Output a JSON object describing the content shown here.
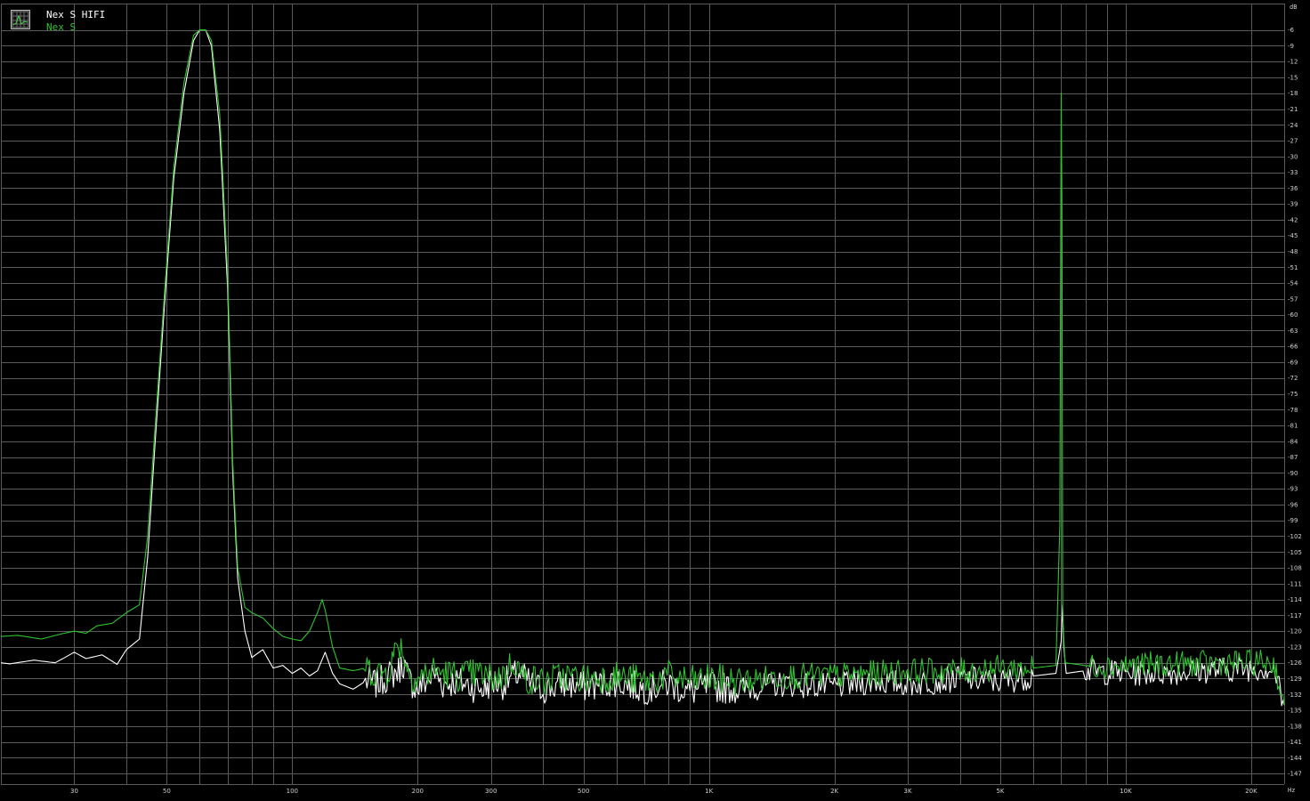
{
  "legend": {
    "series_1": "Nex S HIFI",
    "series_2": "Nex S"
  },
  "colors": {
    "background": "#000000",
    "grid": "#5a5a5a",
    "series_1": "#ffffff",
    "series_2": "#2ec22e",
    "tick_text": "#d0d0d0"
  },
  "icons": {
    "legend": "chart-grid-icon"
  },
  "chart_data": {
    "type": "line",
    "title": "",
    "xlabel": "Hz",
    "ylabel": "dB",
    "xscale": "log",
    "xlim": [
      20,
      24000
    ],
    "ylim": [
      -149,
      -1
    ],
    "grid": true,
    "legend_position": "top-left",
    "x_ticks": [
      {
        "value": 30,
        "label": "30"
      },
      {
        "value": 50,
        "label": "50"
      },
      {
        "value": 100,
        "label": "100"
      },
      {
        "value": 200,
        "label": "200"
      },
      {
        "value": 300,
        "label": "300"
      },
      {
        "value": 500,
        "label": "500"
      },
      {
        "value": 1000,
        "label": "1K"
      },
      {
        "value": 2000,
        "label": "2K"
      },
      {
        "value": 3000,
        "label": "3K"
      },
      {
        "value": 5000,
        "label": "5K"
      },
      {
        "value": 10000,
        "label": "10K"
      },
      {
        "value": 20000,
        "label": "20K"
      }
    ],
    "x_grid_minor": [
      20,
      40,
      60,
      70,
      80,
      90,
      400,
      600,
      700,
      800,
      900,
      4000,
      6000,
      7000,
      8000,
      9000
    ],
    "y_ticks": [
      -6,
      -9,
      -12,
      -15,
      -18,
      -21,
      -24,
      -27,
      -30,
      -33,
      -36,
      -39,
      -42,
      -45,
      -48,
      -51,
      -54,
      -57,
      -60,
      -63,
      -66,
      -69,
      -72,
      -75,
      -78,
      -81,
      -84,
      -87,
      -90,
      -93,
      -96,
      -99,
      -102,
      -105,
      -108,
      -111,
      -114,
      -117,
      -120,
      -123,
      -126,
      -129,
      -132,
      -135,
      -138,
      -141,
      -144,
      -147
    ],
    "series": [
      {
        "name": "Nex S HIFI",
        "color": "#ffffff",
        "points": [
          [
            20,
            -126
          ],
          [
            21,
            -126.2
          ],
          [
            24,
            -125.5
          ],
          [
            27,
            -126
          ],
          [
            30,
            -124
          ],
          [
            32,
            -125.2
          ],
          [
            35,
            -124.5
          ],
          [
            38,
            -126.3
          ],
          [
            40,
            -123.5
          ],
          [
            43,
            -121.5
          ],
          [
            45,
            -106
          ],
          [
            47,
            -83
          ],
          [
            50,
            -52
          ],
          [
            52,
            -34
          ],
          [
            55,
            -18
          ],
          [
            58,
            -8
          ],
          [
            60,
            -6
          ],
          [
            62,
            -6
          ],
          [
            64,
            -9
          ],
          [
            67,
            -25
          ],
          [
            70,
            -55
          ],
          [
            72,
            -90
          ],
          [
            74,
            -110
          ],
          [
            77,
            -120
          ],
          [
            80,
            -125
          ],
          [
            85,
            -123.5
          ],
          [
            90,
            -127
          ],
          [
            95,
            -126.5
          ],
          [
            100,
            -128
          ],
          [
            105,
            -127
          ],
          [
            110,
            -128.5
          ],
          [
            115,
            -127.5
          ],
          [
            120,
            -124
          ],
          [
            125,
            -128
          ],
          [
            130,
            -130
          ],
          [
            135,
            -130.5
          ],
          [
            140,
            -131
          ],
          [
            150,
            -129.5
          ],
          [
            160,
            -130
          ],
          [
            170,
            -128.5
          ],
          [
            180,
            -127.5
          ],
          [
            185,
            -126
          ],
          [
            190,
            -129
          ],
          [
            200,
            -131
          ],
          [
            210,
            -129.5
          ],
          [
            220,
            -128
          ],
          [
            230,
            -130
          ],
          [
            250,
            -129.5
          ],
          [
            270,
            -130.5
          ],
          [
            290,
            -131
          ],
          [
            300,
            -129.5
          ],
          [
            320,
            -130
          ],
          [
            350,
            -128
          ],
          [
            380,
            -130.5
          ],
          [
            400,
            -131
          ],
          [
            450,
            -130
          ],
          [
            500,
            -130.5
          ],
          [
            600,
            -129.5
          ],
          [
            700,
            -131
          ],
          [
            800,
            -130
          ],
          [
            900,
            -131.5
          ],
          [
            1000,
            -130.5
          ],
          [
            1200,
            -131
          ],
          [
            1500,
            -130
          ],
          [
            2000,
            -130.5
          ],
          [
            2500,
            -129.5
          ],
          [
            3000,
            -130
          ],
          [
            4000,
            -129
          ],
          [
            5000,
            -129.5
          ],
          [
            6000,
            -128.5
          ],
          [
            6800,
            -128
          ],
          [
            7000,
            -122
          ],
          [
            7050,
            -115
          ],
          [
            7100,
            -123
          ],
          [
            7200,
            -128
          ],
          [
            8000,
            -127.5
          ],
          [
            10000,
            -128
          ],
          [
            12000,
            -127.8
          ],
          [
            15000,
            -127.5
          ],
          [
            18000,
            -127.2
          ],
          [
            20000,
            -127
          ],
          [
            22000,
            -127
          ],
          [
            22800,
            -127.5
          ],
          [
            23500,
            -132
          ],
          [
            24000,
            -134
          ]
        ]
      },
      {
        "name": "Nex S",
        "color": "#2ec22e",
        "points": [
          [
            20,
            -121
          ],
          [
            22,
            -120.8
          ],
          [
            25,
            -121.5
          ],
          [
            28,
            -120.5
          ],
          [
            30,
            -120
          ],
          [
            32,
            -120.4
          ],
          [
            34,
            -119
          ],
          [
            37,
            -118.5
          ],
          [
            40,
            -116.5
          ],
          [
            43,
            -115
          ],
          [
            45,
            -102
          ],
          [
            47,
            -80
          ],
          [
            50,
            -50
          ],
          [
            52,
            -32
          ],
          [
            55,
            -16
          ],
          [
            58,
            -7
          ],
          [
            60,
            -6
          ],
          [
            62,
            -6
          ],
          [
            64,
            -8
          ],
          [
            67,
            -22
          ],
          [
            70,
            -52
          ],
          [
            72,
            -88
          ],
          [
            74,
            -108
          ],
          [
            77,
            -115.5
          ],
          [
            80,
            -116.5
          ],
          [
            85,
            -117.5
          ],
          [
            90,
            -119.5
          ],
          [
            95,
            -121
          ],
          [
            100,
            -121.5
          ],
          [
            105,
            -121.8
          ],
          [
            110,
            -120
          ],
          [
            115,
            -116.5
          ],
          [
            118,
            -114
          ],
          [
            120,
            -116
          ],
          [
            125,
            -123
          ],
          [
            130,
            -127
          ],
          [
            140,
            -127.5
          ],
          [
            150,
            -127
          ],
          [
            160,
            -128
          ],
          [
            170,
            -127.5
          ],
          [
            180,
            -122
          ],
          [
            185,
            -124
          ],
          [
            190,
            -128
          ],
          [
            200,
            -129
          ],
          [
            210,
            -128
          ],
          [
            220,
            -127.5
          ],
          [
            250,
            -128.5
          ],
          [
            280,
            -128
          ],
          [
            300,
            -129
          ],
          [
            320,
            -128.5
          ],
          [
            340,
            -125.5
          ],
          [
            360,
            -129
          ],
          [
            400,
            -129.5
          ],
          [
            450,
            -128.5
          ],
          [
            500,
            -129
          ],
          [
            600,
            -128.5
          ],
          [
            700,
            -129.5
          ],
          [
            800,
            -128.5
          ],
          [
            900,
            -129.5
          ],
          [
            1000,
            -129
          ],
          [
            1200,
            -129.5
          ],
          [
            1500,
            -128.5
          ],
          [
            2000,
            -128.5
          ],
          [
            2500,
            -128
          ],
          [
            3000,
            -127.5
          ],
          [
            4000,
            -127.5
          ],
          [
            5000,
            -127
          ],
          [
            6000,
            -127
          ],
          [
            6800,
            -126.5
          ],
          [
            6950,
            -100
          ],
          [
            7000,
            -18
          ],
          [
            7030,
            -40
          ],
          [
            7060,
            -117
          ],
          [
            7150,
            -126
          ],
          [
            8000,
            -126.5
          ],
          [
            10000,
            -126.5
          ],
          [
            12000,
            -126.3
          ],
          [
            15000,
            -126.2
          ],
          [
            18000,
            -126
          ],
          [
            20000,
            -126
          ],
          [
            22000,
            -125.8
          ],
          [
            22800,
            -126.5
          ],
          [
            23500,
            -131
          ],
          [
            24000,
            -134
          ]
        ]
      }
    ]
  }
}
